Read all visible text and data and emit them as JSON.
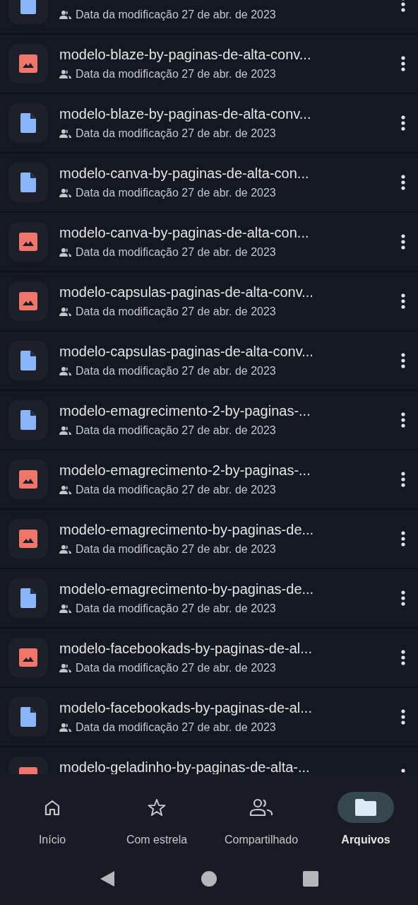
{
  "files": [
    {
      "kind": "document",
      "date": "Data da modificação 27 de abr. de 2023"
    },
    {
      "kind": "image",
      "title": "modelo-blaze-by-paginas-de-alta-conv...",
      "date": "Data da modificação 27 de abr. de 2023"
    },
    {
      "kind": "document",
      "title": "modelo-blaze-by-paginas-de-alta-conv...",
      "date": "Data da modificação 27 de abr. de 2023"
    },
    {
      "kind": "document",
      "title": "modelo-canva-by-paginas-de-alta-con...",
      "date": "Data da modificação 27 de abr. de 2023"
    },
    {
      "kind": "image",
      "title": "modelo-canva-by-paginas-de-alta-con...",
      "date": "Data da modificação 27 de abr. de 2023"
    },
    {
      "kind": "image",
      "title": "modelo-capsulas-paginas-de-alta-conv...",
      "date": "Data da modificação 27 de abr. de 2023"
    },
    {
      "kind": "document",
      "title": "modelo-capsulas-paginas-de-alta-conv...",
      "date": "Data da modificação 27 de abr. de 2023"
    },
    {
      "kind": "document",
      "title": "modelo-emagrecimento-2-by-paginas-...",
      "date": "Data da modificação 27 de abr. de 2023"
    },
    {
      "kind": "image",
      "title": "modelo-emagrecimento-2-by-paginas-...",
      "date": "Data da modificação 27 de abr. de 2023"
    },
    {
      "kind": "image",
      "title": "modelo-emagrecimento-by-paginas-de...",
      "date": "Data da modificação 27 de abr. de 2023"
    },
    {
      "kind": "document",
      "title": "modelo-emagrecimento-by-paginas-de...",
      "date": "Data da modificação 27 de abr. de 2023"
    },
    {
      "kind": "image",
      "title": "modelo-facebookads-by-paginas-de-al...",
      "date": "Data da modificação 27 de abr. de 2023"
    },
    {
      "kind": "document",
      "title": "modelo-facebookads-by-paginas-de-al...",
      "date": "Data da modificação 27 de abr. de 2023"
    },
    {
      "kind": "image",
      "title": "modelo-geladinho-by-paginas-de-alta-..."
    }
  ],
  "nav": [
    {
      "label": "Início",
      "selected": false
    },
    {
      "label": "Com estrela",
      "selected": false
    },
    {
      "label": "Compartilhado",
      "selected": false
    },
    {
      "label": "Arquivos",
      "selected": true
    }
  ]
}
